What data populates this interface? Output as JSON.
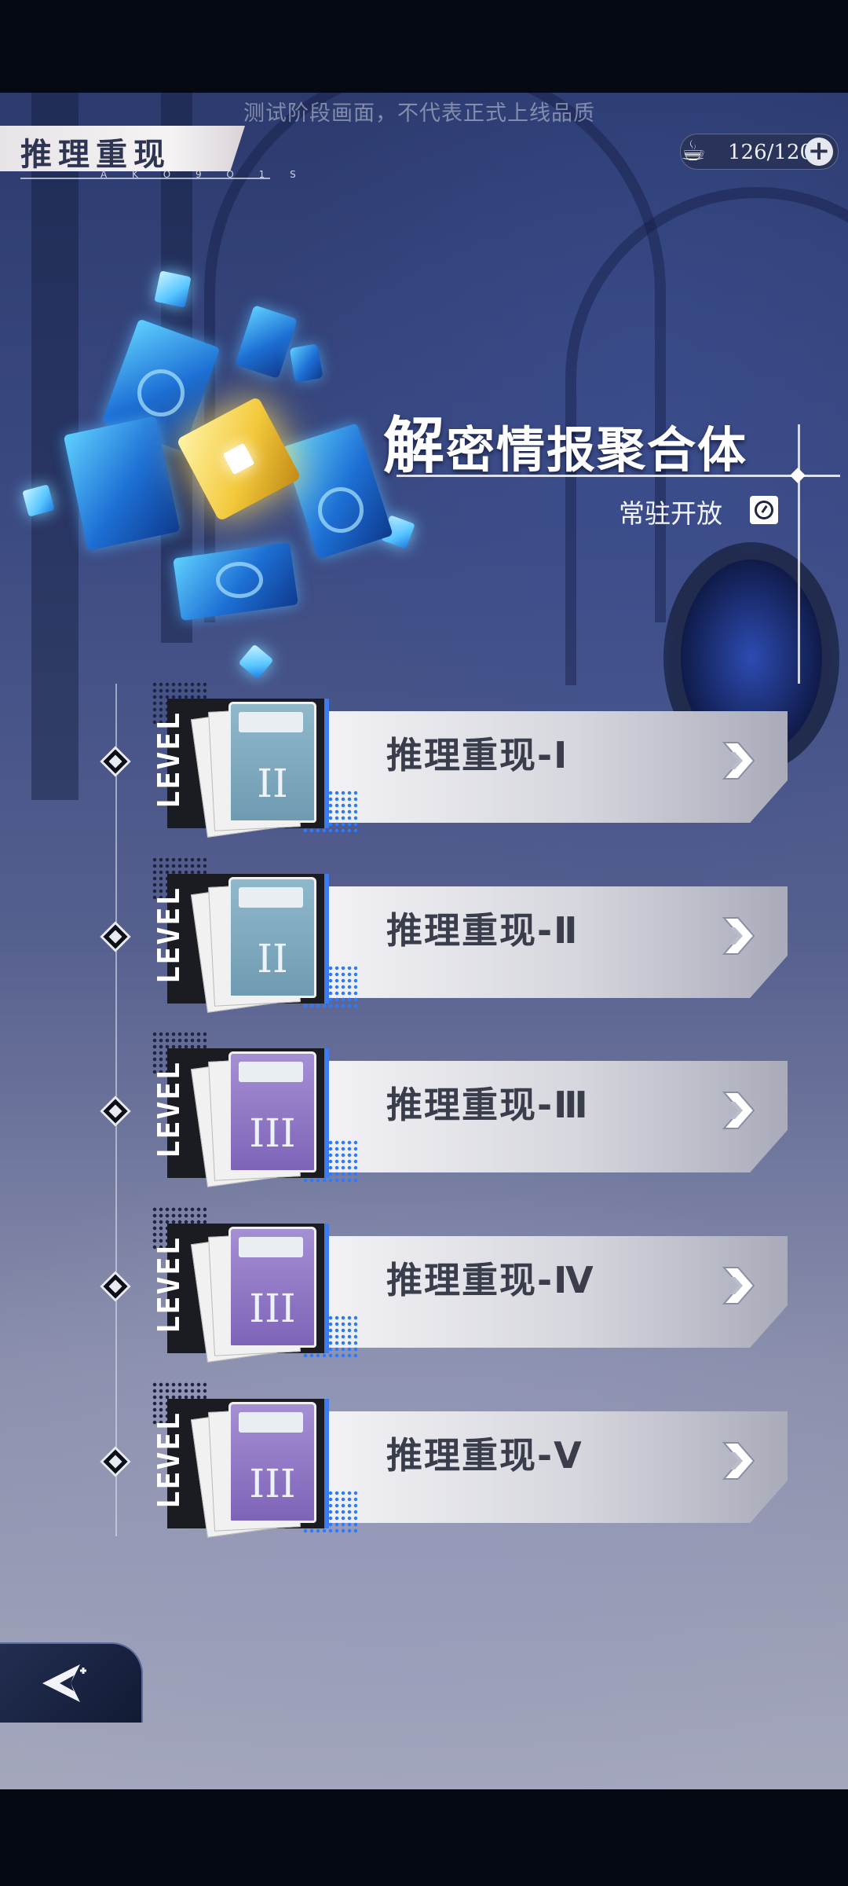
{
  "watermark": "测试阶段画面，不代表正式上线品质",
  "header": {
    "title": "推理重现",
    "subtitle": "A K O 9 O 1 S"
  },
  "currency": {
    "icon": "coffee-cup-icon",
    "value": "126/120",
    "add_label": "+"
  },
  "event": {
    "title_first": "解",
    "title_rest": "密情报聚合体",
    "status": "常驻开放",
    "status_icon": "clock-icon"
  },
  "levels": [
    {
      "label": "推理重现-Ⅰ",
      "roman": "II",
      "color": "blue"
    },
    {
      "label": "推理重现-Ⅱ",
      "roman": "II",
      "color": "blue"
    },
    {
      "label": "推理重现-Ⅲ",
      "roman": "III",
      "color": "purple"
    },
    {
      "label": "推理重现-Ⅳ",
      "roman": "III",
      "color": "purple"
    },
    {
      "label": "推理重现-Ⅴ",
      "roman": "III",
      "color": "purple"
    }
  ],
  "level_word": "LEVEL",
  "back_button_icon": "back-arrow-icon",
  "colors": {
    "accent_blue": "#2c7bff",
    "file_blue": "#7fa9be",
    "file_purple": "#8f76c6",
    "panel_text": "#3a3d4c"
  }
}
